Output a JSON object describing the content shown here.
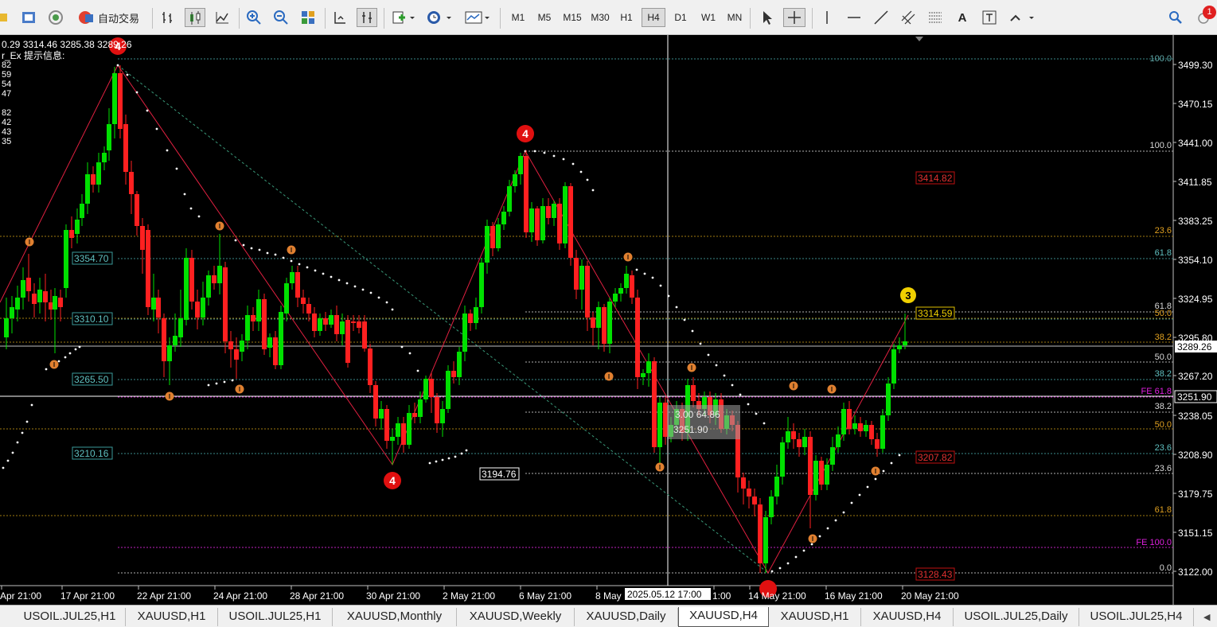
{
  "toolbar": {
    "auto_trading_label": "自动交易",
    "timeframes": [
      "M1",
      "M5",
      "M15",
      "M30",
      "H1",
      "H4",
      "D1",
      "W1",
      "MN"
    ],
    "active_timeframe": "H4",
    "notification_count": "1"
  },
  "chart": {
    "symbol_ohlc": "0.29 3314.46 3285.38 3289.26",
    "indicator_label": "r_Ex 提示信息:",
    "left_numbers": [
      "82",
      "59",
      "54",
      "47",
      "82",
      "42",
      "43",
      "35"
    ],
    "price_ticks": [
      "3499.30",
      "3470.15",
      "3441.00",
      "3411.85",
      "3383.25",
      "3354.10",
      "3324.95",
      "3295.80",
      "3267.20",
      "3238.05",
      "3208.90",
      "3179.75",
      "3151.15",
      "3122.00"
    ],
    "current_price": "3289.26",
    "crosshair_price": "3251.90",
    "crosshair_time": "2025.05.12 17:00",
    "date_ticks": [
      "Apr 21:00",
      "17 Apr 21:00",
      "22 Apr 21:00",
      "24 Apr 21:00",
      "28 Apr 21:00",
      "30 Apr 21:00",
      "2 May 21:00",
      "6 May 21:00",
      "8 May",
      "1:00",
      "14 May 21:00",
      "16 May 21:00",
      "20 May 21:00"
    ],
    "level_tags_left": [
      "3354.70",
      "3310.10",
      "3265.50",
      "3210.16"
    ],
    "level_tag_mid": "3194.76",
    "red_tags": [
      "3414.82",
      "3207.82",
      "3128.43"
    ],
    "yellow_tag": "3314.59",
    "crosshair_box": [
      "3.00 64.86",
      "3251.90"
    ],
    "fib_right_labels": [
      {
        "text": "100.0",
        "color": "#5fa8a8"
      },
      {
        "text": "100.0",
        "color": "#d8d8d8"
      },
      {
        "text": "23.6",
        "color": "#e0a020"
      },
      {
        "text": "61.8",
        "color": "#5fc0c0"
      },
      {
        "text": "61.8",
        "color": "#d8d8d8"
      },
      {
        "text": "50.0",
        "color": "#e0a020"
      },
      {
        "text": "38.2",
        "color": "#e0a020"
      },
      {
        "text": "50.0",
        "color": "#d8d8d8"
      },
      {
        "text": "38.2",
        "color": "#5fc0c0"
      },
      {
        "text": "FE 61.8",
        "color": "#e020e0"
      },
      {
        "text": "38.2",
        "color": "#d8d8d8"
      },
      {
        "text": "50.0",
        "color": "#e0a020"
      },
      {
        "text": "23.6",
        "color": "#5fc0c0"
      },
      {
        "text": "23.6",
        "color": "#d8d8d8"
      },
      {
        "text": "61.8",
        "color": "#e0a020"
      },
      {
        "text": "FE 100.0",
        "color": "#e020e0"
      },
      {
        "text": "0.0",
        "color": "#d8d8d8"
      }
    ],
    "wave_labels": [
      "4",
      "4",
      "3"
    ]
  },
  "tabs": [
    "USOIL.JUL25,H1",
    "XAUUSD,H1",
    "USOIL.JUL25,H1",
    "XAUUSD,Monthly",
    "XAUUSD,Weekly",
    "XAUUSD,Daily",
    "XAUUSD,H4",
    "XAUUSD,H1",
    "XAUUSD,H4",
    "USOIL.JUL25,Daily",
    "USOIL.JUL25,H4"
  ],
  "active_tab": "XAUUSD,H4",
  "colors": {
    "bull": "#00e000",
    "bear": "#ff2020",
    "background": "#000000"
  }
}
